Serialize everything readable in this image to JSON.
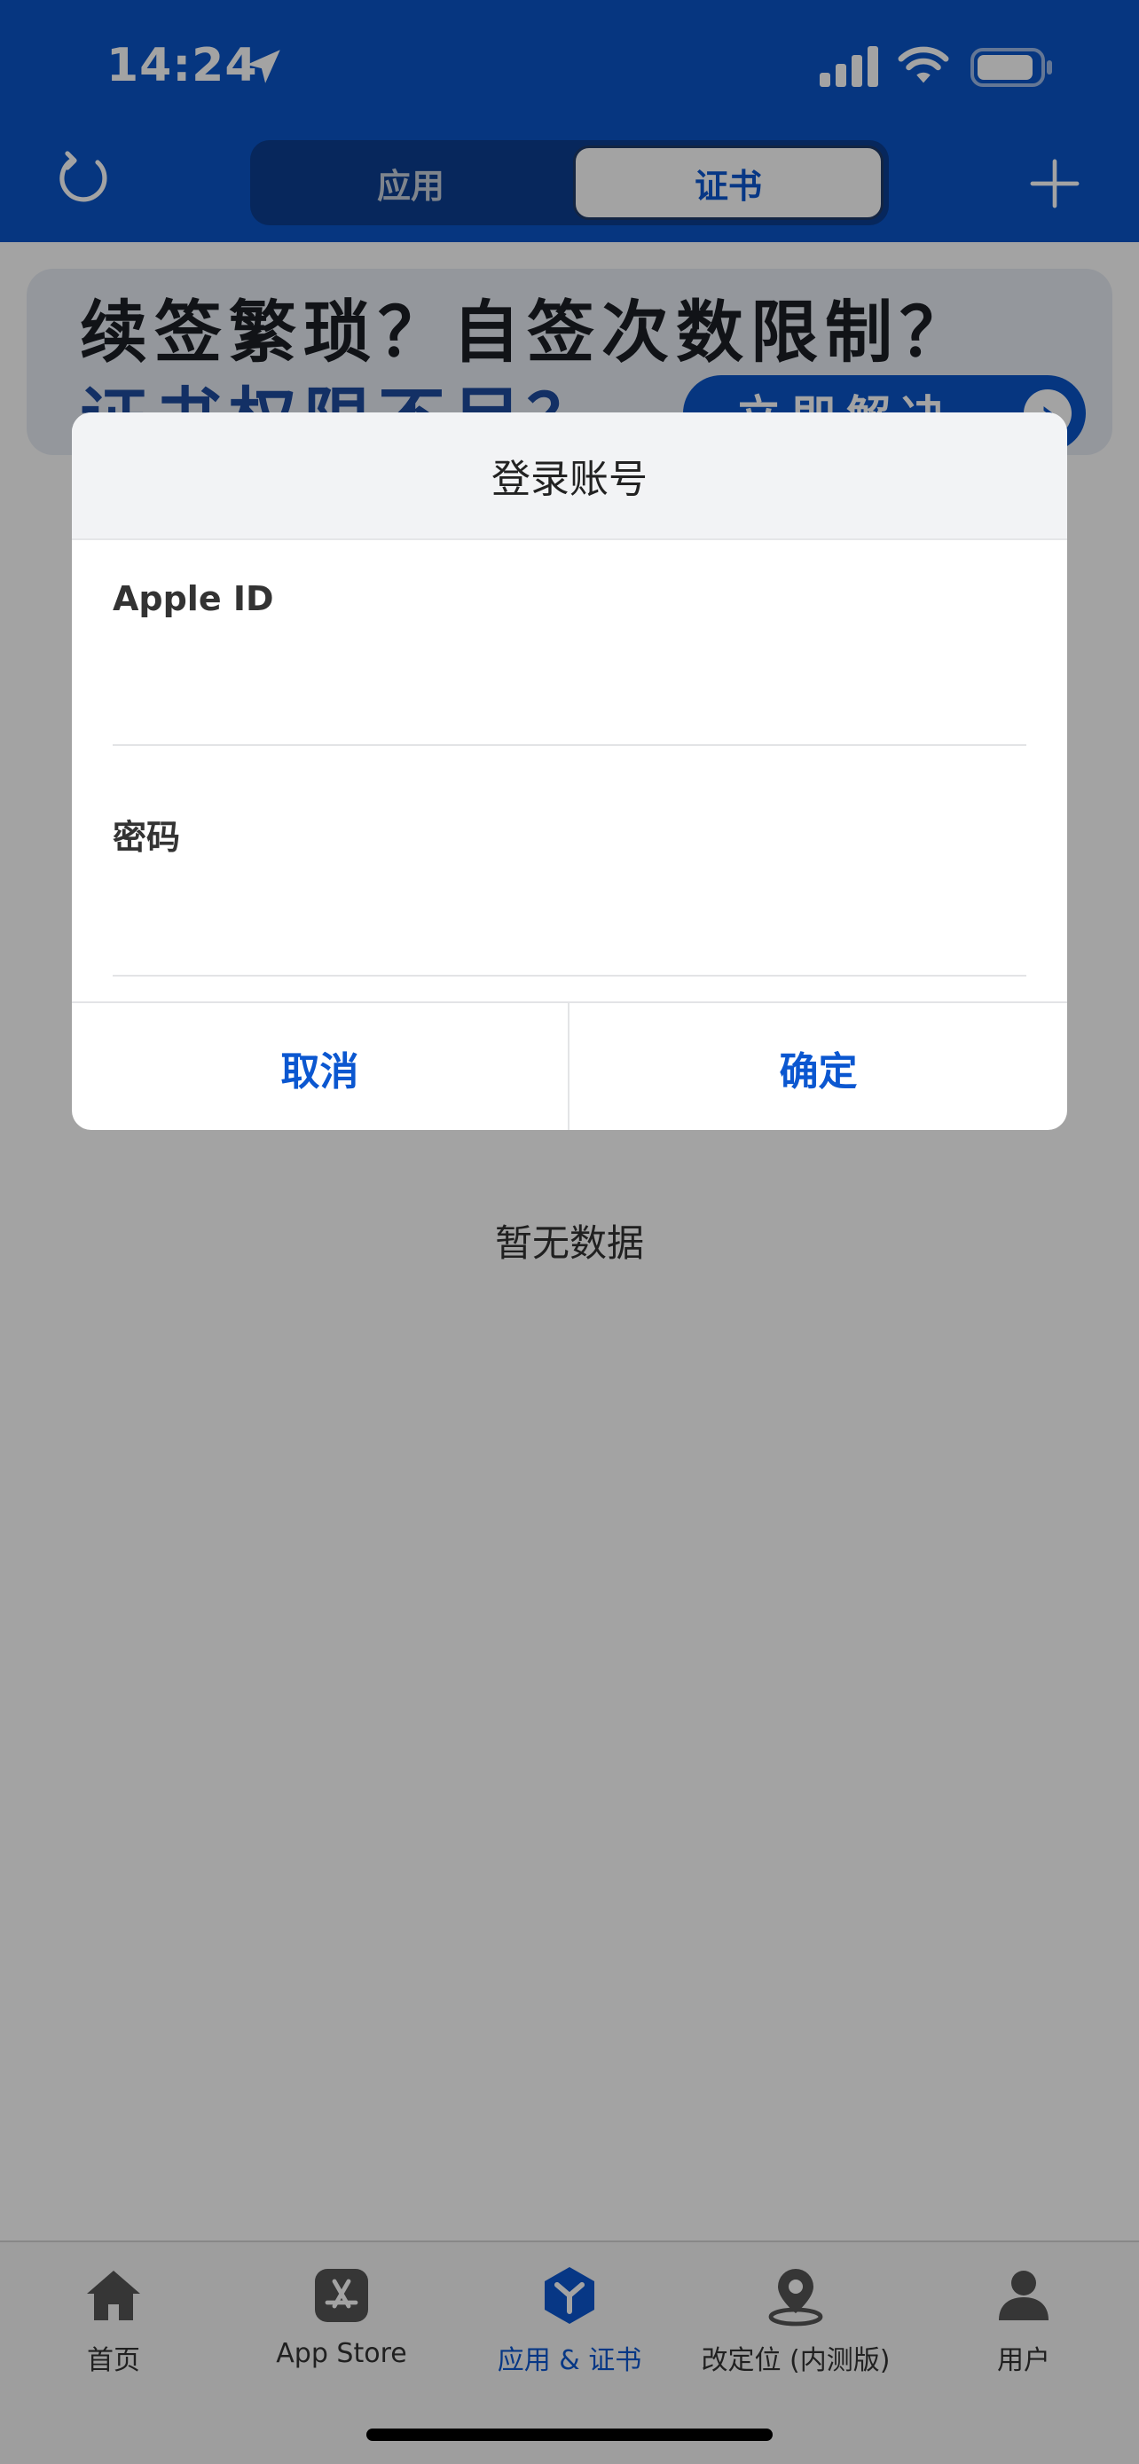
{
  "status_bar": {
    "time": "14:24",
    "icons": [
      "location-arrow-icon",
      "cellular-signal-icon",
      "wifi-icon",
      "battery-icon"
    ]
  },
  "header": {
    "segment": {
      "tabs": [
        "应用",
        "证书"
      ],
      "selected": "证书"
    },
    "left_icon": "refresh-icon",
    "right_icon": "plus-icon"
  },
  "banner": {
    "line1": "续签繁琐？自签次数限制？",
    "line2": "证书权限不足？",
    "button_label": "立即解决",
    "button_arrow": "›"
  },
  "empty_state": {
    "text": "暂无数据"
  },
  "dialog": {
    "title": "登录账号",
    "apple_id": {
      "label": "Apple ID",
      "value": ""
    },
    "password": {
      "label": "密码",
      "value": ""
    },
    "cancel_label": "取消",
    "confirm_label": "确定"
  },
  "tab_bar": {
    "items": [
      {
        "label": "首页",
        "icon": "home-icon",
        "active": false
      },
      {
        "label": "App Store",
        "icon": "app-store-icon",
        "active": false
      },
      {
        "label": "应用 & 证书",
        "icon": "cert-app-icon",
        "active": true
      },
      {
        "label": "改定位 (内测版)",
        "icon": "location-pin-icon",
        "active": false
      },
      {
        "label": "用户",
        "icon": "user-icon",
        "active": false
      }
    ]
  },
  "colors": {
    "brand_blue": "#0a55c8",
    "accent_text": "#0b57d0",
    "overlay": "rgba(0,0,0,0.36)"
  }
}
